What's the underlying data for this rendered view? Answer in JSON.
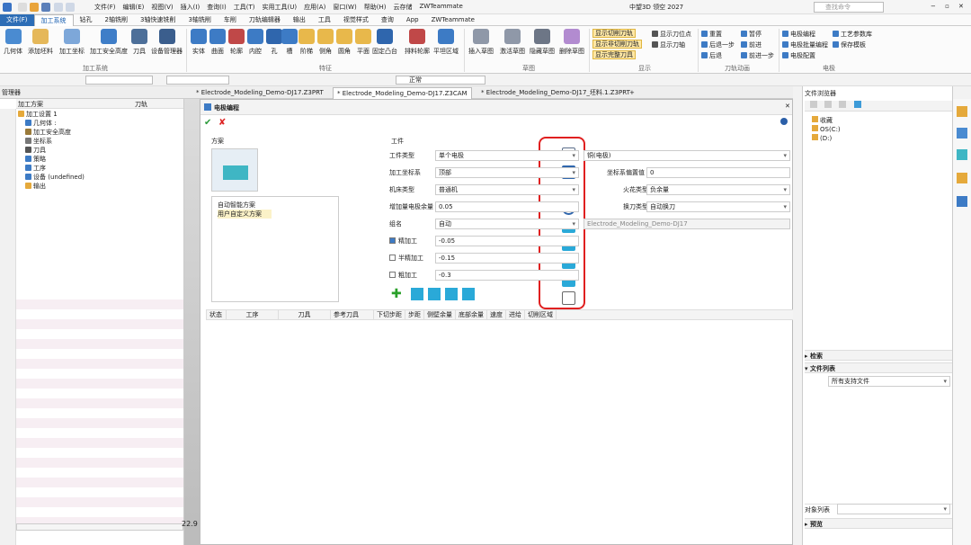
{
  "menu": [
    "文件(F)",
    "编辑(E)",
    "视图(V)",
    "插入(I)",
    "查询(I)",
    "工具(T)",
    "实用工具(U)",
    "应用(A)",
    "窗口(W)",
    "帮助(H)",
    "云存储",
    "ZWTeammate"
  ],
  "app_title": "中望3D 领空 2027",
  "search_placeholder": "查找命令",
  "tabs": [
    "文件(F)",
    "加工系统",
    "钻孔",
    "2轴铣削",
    "3轴快速铣削",
    "3轴铣削",
    "车削",
    "刀轨编辑器",
    "输出",
    "工具",
    "视觉样式",
    "查询",
    "App",
    "ZWTeammate"
  ],
  "ribbon": {
    "sys_buttons": [
      "几何体",
      "添加坯料",
      "加工坐标",
      "加工安全高度",
      "刀具",
      "设备管理器"
    ],
    "sys_group": "加工系统",
    "feat_buttons": [
      "实体",
      "曲面",
      "轮廓",
      "内腔",
      "孔",
      "槽",
      "阶梯",
      "侧角",
      "圆角",
      "平面",
      "固定凸台",
      "排料轮廓",
      "平坦区域"
    ],
    "feat_group": "特征",
    "sketch_buttons": [
      "插入草图",
      "激活草图",
      "隐藏草图",
      "删除草图"
    ],
    "sketch_group": "草图",
    "show_items": [
      "显示切削刀轨",
      "显示非切削刀轨",
      "显示完整刀具",
      "显示刀位点",
      "显示刀轴"
    ],
    "show_group": "显示",
    "toolpath_items": [
      "重置",
      "暂停",
      "后退一步",
      "前进",
      "后退",
      "前进一步"
    ],
    "toolpath_group": "刀轨动画",
    "electrode_items": [
      "电极编程",
      "工艺参数库",
      "电极批量编程",
      "保存模板",
      "电极配置"
    ],
    "electrode_group": "电极"
  },
  "qbar": {
    "filter": "正常"
  },
  "doc_tabs": [
    "* Electrode_Modeling_Demo-DJ17.Z3PRT",
    "* Electrode_Modeling_Demo-DJ17.Z3CAM",
    "* Electrode_Modeling_Demo-DJ17_坯料.1.Z3PRT"
  ],
  "left": {
    "panel_title": "管理器",
    "col1": "加工方案",
    "col2": "刀轨",
    "tree": [
      "加工设置 1",
      "几何体 :",
      "加工安全高度",
      "坐标系",
      "刀具",
      "策略",
      "工序",
      "设备 (undefined)",
      "输出"
    ]
  },
  "canvas": {
    "coord": "22.9"
  },
  "dialog": {
    "title": "电极编程",
    "section_scheme": "方案",
    "schemes": [
      "自动智能方案",
      "用户自定义方案"
    ],
    "section_workpiece": "工件",
    "rows": [
      {
        "label": "工件类型",
        "value": "单个电极",
        "label2": "",
        "value2": "铜(电极)"
      },
      {
        "label": "加工坐标系",
        "value": "顶部",
        "label2": "坐标系偏置值",
        "value2": "0"
      },
      {
        "label": "机床类型",
        "value": "普通机",
        "label2": "火花类型",
        "value2": "负余量"
      },
      {
        "label": "增加量电极余量",
        "value": "0.05",
        "label2": "换刀类型",
        "value2": "自动换刀"
      },
      {
        "label": "组名",
        "value": "自动",
        "label2": "",
        "value2": "Electrode_Modeling_Demo-DJ17"
      }
    ],
    "passes": [
      {
        "label": "精加工",
        "value": "-0.05",
        "checked": true
      },
      {
        "label": "半精加工",
        "value": "-0.15",
        "checked": false
      },
      {
        "label": "粗加工",
        "value": "-0.3",
        "checked": false
      }
    ],
    "table_headers": [
      "状态",
      "工序",
      "刀具",
      "参考刀具",
      "下切步距",
      "步距",
      "侧壁余量",
      "底部余量",
      "速度",
      "进给",
      "切削区域"
    ]
  },
  "right": {
    "title": "文件浏览器",
    "items": [
      "收藏",
      "OS(C:)",
      "(D:)"
    ],
    "sec_search": "检索",
    "sec_list": "文件列表",
    "filter": "所有支持文件",
    "obj_list": "对象列表",
    "preview": "预览"
  },
  "colors": {
    "accent": "#2d6db6",
    "highlight": "#ffe8a6",
    "redbox": "#e02020"
  }
}
